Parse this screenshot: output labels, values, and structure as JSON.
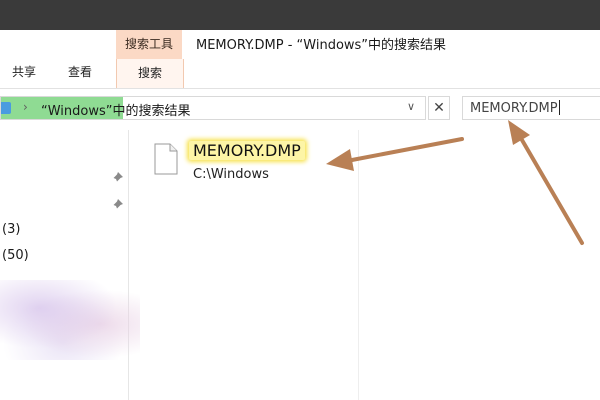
{
  "window": {
    "title": "MEMORY.DMP - “Windows”中的搜索结果"
  },
  "ribbon": {
    "context_tab_header": "搜索工具",
    "tabs": [
      {
        "label": "共享"
      },
      {
        "label": "查看"
      },
      {
        "label": "搜索"
      }
    ]
  },
  "address_bar": {
    "path": "“Windows”中的搜索结果",
    "chevron": "›",
    "dropdown": "∨"
  },
  "close_button": {
    "label": "✕"
  },
  "search": {
    "value": "MEMORY.DMP"
  },
  "nav_pane": {
    "items": [
      {
        "label": "(3)"
      },
      {
        "label": "(50)"
      }
    ]
  },
  "results": [
    {
      "name": "MEMORY.DMP",
      "path": "C:\\Windows"
    }
  ],
  "colors": {
    "context_tab": "#fbd9c5",
    "address_highlight": "#8fdb93",
    "match_highlight": "#fdf5a6",
    "annotation_arrow": "#b98055"
  },
  "icons": [
    "folder-icon",
    "pin-icon",
    "file-icon",
    "close-icon"
  ]
}
